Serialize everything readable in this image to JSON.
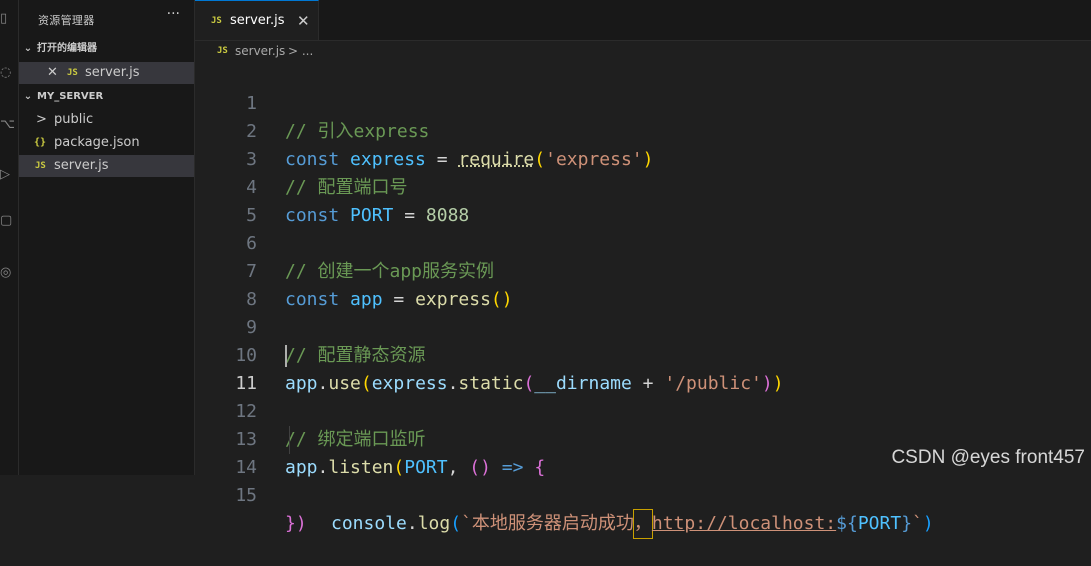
{
  "sidebar": {
    "title": "资源管理器",
    "more": "···",
    "open_editors": {
      "label": "打开的编辑器",
      "items": [
        {
          "close": "✕",
          "badge": "JS",
          "name": "server.js"
        }
      ]
    },
    "project": {
      "label": "MY_SERVER",
      "items": [
        {
          "icon": ">",
          "name": "public"
        },
        {
          "icon": "{}",
          "name": "package.json"
        },
        {
          "icon": "JS",
          "name": "server.js"
        }
      ]
    }
  },
  "tab": {
    "badge": "JS",
    "label": "server.js",
    "close": "✕"
  },
  "breadcrumb": {
    "badge": "JS",
    "file": "server.js",
    "rest": "> ..."
  },
  "editor": {
    "active_line": 11,
    "line_numbers": [
      "1",
      "2",
      "3",
      "4",
      "5",
      "6",
      "7",
      "8",
      "9",
      "10",
      "11",
      "12",
      "13",
      "14",
      "15"
    ],
    "lines": {
      "l1_comment": "// 引入express",
      "l2_const": "const",
      "l2_var": "express",
      "l2_eq": " = ",
      "l2_fn": "require",
      "l2_open": "(",
      "l2_str": "'express'",
      "l2_close": ")",
      "l3_comment": "// 配置端口号",
      "l4_const": "const",
      "l4_var": "PORT",
      "l4_eq": " = ",
      "l4_num": "8088",
      "l6_comment": "// 创建一个app服务实例",
      "l7_const": "const",
      "l7_var": "app",
      "l7_eq": " = ",
      "l7_fn": "express",
      "l7_parens": "()",
      "l9_comment": "// 配置静态资源",
      "l10_obj": "app",
      "l10_dot": ".",
      "l10_fn": "use",
      "l10_open": "(",
      "l10_obj2": "express",
      "l10_dot2": ".",
      "l10_fn2": "static",
      "l10_open2": "(",
      "l10_var": "__dirname",
      "l10_plus": " + ",
      "l10_str": "'/public'",
      "l10_close2": ")",
      "l10_close": ")",
      "l12_comment": "// 绑定端口监听",
      "l13_obj": "app",
      "l13_dot": ".",
      "l13_fn": "listen",
      "l13_open": "(",
      "l13_var": "PORT",
      "l13_comma": ", ",
      "l13_parens": "()",
      "l13_arrow": " => ",
      "l13_brace": "{",
      "l14_obj": "console",
      "l14_dot": ".",
      "l14_fn": "log",
      "l14_open": "(",
      "l14_tick": "`",
      "l14_text": "本地服务器启动成功",
      "l14_sel": "，",
      "l14_url": "http://localhost:",
      "l14_dollar": "${",
      "l14_var": "PORT",
      "l14_rbrace": "}",
      "l14_tick2": "`",
      "l14_close": ")",
      "l15_brace": "})"
    }
  },
  "watermark": "CSDN @eyes front457"
}
